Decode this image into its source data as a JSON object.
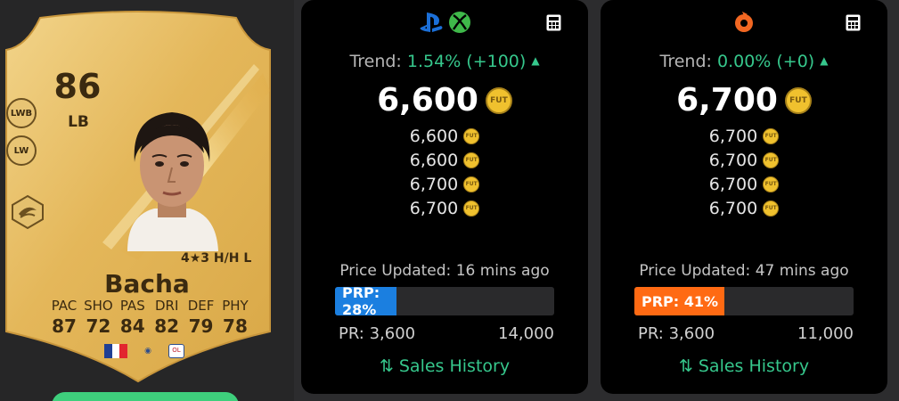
{
  "player": {
    "rating": "86",
    "position": "LB",
    "alt_positions": [
      "LWB",
      "LW"
    ],
    "name": "Bacha",
    "skills_line": "4★3 H/H L",
    "stats": [
      {
        "label": "PAC",
        "value": "87"
      },
      {
        "label": "SHO",
        "value": "72"
      },
      {
        "label": "PAS",
        "value": "84"
      },
      {
        "label": "DRI",
        "value": "82"
      },
      {
        "label": "DEF",
        "value": "79"
      },
      {
        "label": "PHY",
        "value": "78"
      }
    ],
    "nation": "France",
    "club": "OL",
    "card_color": "#e2b960",
    "text_color": "#3b2a10"
  },
  "panels": [
    {
      "platform_icons": [
        "playstation-icon",
        "xbox-icon"
      ],
      "trend_label": "Trend:",
      "trend_value": "1.54% (+100)",
      "price": "6,600",
      "recent_prices": [
        "6,600",
        "6,600",
        "6,700",
        "6,700"
      ],
      "updated": "Price Updated: 16 mins ago",
      "prp_label": "PRP: 28%",
      "prp_fraction": 0.28,
      "prp_color": "#1b7fe0",
      "range_min": "PR: 3,600",
      "range_max": "14,000",
      "sales_label": "Sales History"
    },
    {
      "platform_icons": [
        "origin-icon"
      ],
      "trend_label": "Trend:",
      "trend_value": "0.00% (+0)",
      "price": "6,700",
      "recent_prices": [
        "6,700",
        "6,700",
        "6,700",
        "6,700"
      ],
      "updated": "Price Updated: 47 mins ago",
      "prp_label": "PRP: 41%",
      "prp_fraction": 0.41,
      "prp_color": "#ff6a13",
      "range_min": "PR: 3,600",
      "range_max": "11,000",
      "sales_label": "Sales History"
    }
  ],
  "coin_label": "FUT",
  "accent_green": "#36c78c"
}
